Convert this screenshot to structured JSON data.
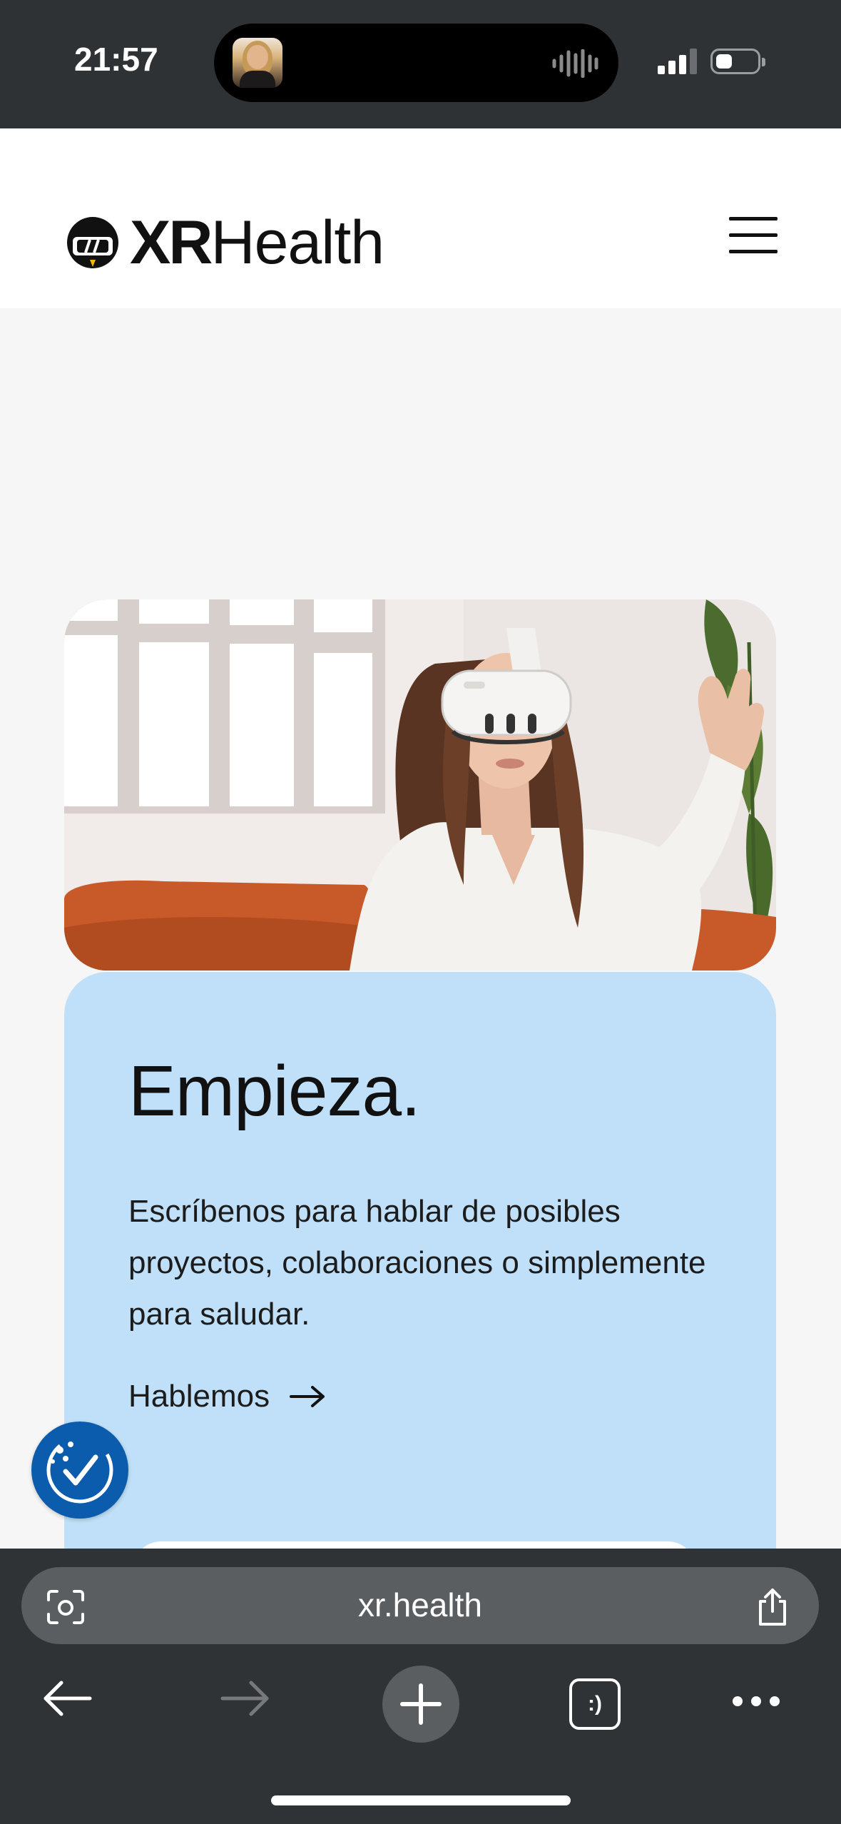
{
  "status_bar": {
    "time": "21:57",
    "icons": [
      "now-playing-avatar",
      "audio-waveform-icon",
      "cellular-signal-icon",
      "battery-icon"
    ]
  },
  "header": {
    "logo": {
      "xr": "XR",
      "health": "Health"
    },
    "menu_icon": "hamburger-menu-icon"
  },
  "hero": {
    "image": "woman-wearing-vr-headset-on-sofa"
  },
  "card": {
    "title": "Empieza.",
    "text": "Escríbenos para hablar de posibles proyectos, colaboraciones o simplemente para saludar.",
    "cta_label": "Hablemos",
    "cta_icon": "arrow-right-icon",
    "background": "#bfe0f8"
  },
  "accessibility_widget": {
    "icon": "accessibility-check-icon",
    "color": "#0b5cad"
  },
  "browser": {
    "url": "xr.health",
    "icons": [
      "camera-search-icon",
      "share-icon",
      "back-arrow-icon",
      "forward-arrow-icon",
      "new-tab-plus-icon",
      "tabs-icon",
      "more-icon"
    ],
    "tabs_label": ":)"
  }
}
